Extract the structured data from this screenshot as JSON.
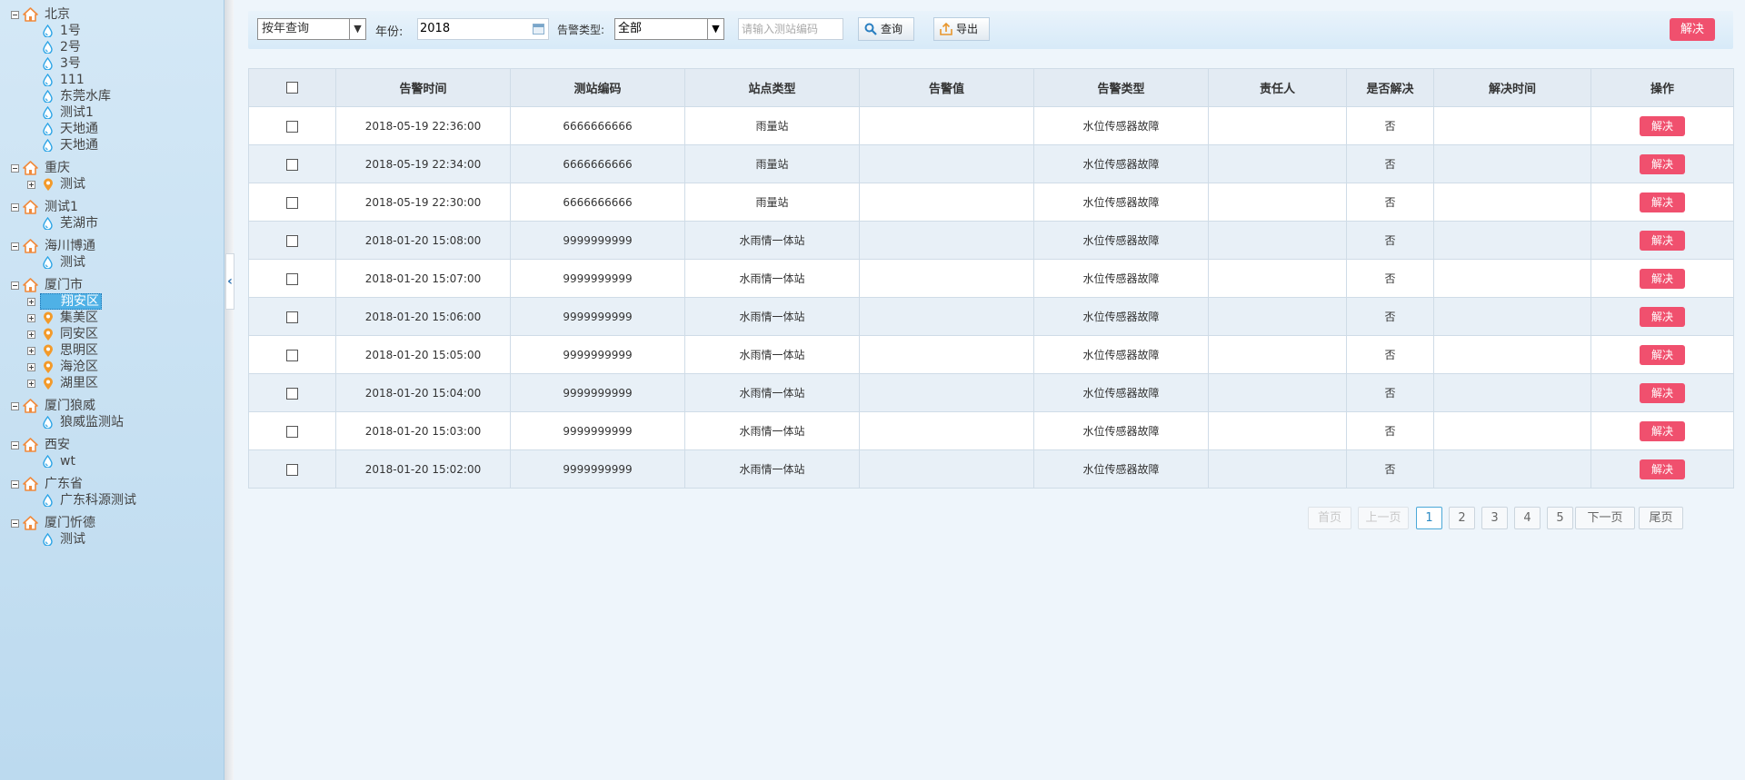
{
  "tree": [
    {
      "label": "北京",
      "children": [
        {
          "label": "1号",
          "icon": "water-drop-icon"
        },
        {
          "label": "2号",
          "icon": "water-drop-icon"
        },
        {
          "label": "3号",
          "icon": "water-drop-icon"
        },
        {
          "label": "111",
          "icon": "water-drop-icon"
        },
        {
          "label": "东莞水库",
          "icon": "water-drop-icon"
        },
        {
          "label": "测试1",
          "icon": "water-drop-icon"
        },
        {
          "label": "天地通",
          "icon": "water-drop-icon"
        },
        {
          "label": "天地通",
          "icon": "water-drop-icon"
        }
      ]
    },
    {
      "label": "重庆",
      "children": [
        {
          "label": "测试",
          "icon": "location-pin-icon",
          "expandable": true
        }
      ]
    },
    {
      "label": "测试1",
      "children": [
        {
          "label": "芜湖市",
          "icon": "water-drop-icon"
        }
      ]
    },
    {
      "label": "海川博通",
      "children": [
        {
          "label": "测试",
          "icon": "water-drop-icon"
        }
      ]
    },
    {
      "label": "厦门市",
      "children": [
        {
          "label": "翔安区",
          "icon": "location-pin-icon",
          "expandable": true,
          "selected": true
        },
        {
          "label": "集美区",
          "icon": "location-pin-icon",
          "expandable": true
        },
        {
          "label": "同安区",
          "icon": "location-pin-icon",
          "expandable": true
        },
        {
          "label": "思明区",
          "icon": "location-pin-icon",
          "expandable": true
        },
        {
          "label": "海沧区",
          "icon": "location-pin-icon",
          "expandable": true
        },
        {
          "label": "湖里区",
          "icon": "location-pin-icon",
          "expandable": true
        }
      ]
    },
    {
      "label": "厦门狼威",
      "children": [
        {
          "label": "狼威监测站",
          "icon": "water-drop-icon"
        }
      ]
    },
    {
      "label": "西安",
      "children": [
        {
          "label": "wt",
          "icon": "water-drop-icon"
        }
      ]
    },
    {
      "label": "广东省",
      "children": [
        {
          "label": "广东科源测试",
          "icon": "water-drop-icon"
        }
      ]
    },
    {
      "label": "厦门忻德",
      "children": [
        {
          "label": "测试",
          "icon": "water-drop-icon"
        }
      ]
    }
  ],
  "toolbar": {
    "query_mode": "按年查询",
    "year_label": "年份:",
    "year_value": "2018",
    "alarm_type_label": "告警类型:",
    "alarm_type_value": "全部",
    "station_placeholder": "请输入测站编码",
    "query_button": "查询",
    "export_button": "导出",
    "solve_button": "解决"
  },
  "table": {
    "headers": [
      "告警时间",
      "测站编码",
      "站点类型",
      "告警值",
      "告警类型",
      "责任人",
      "是否解决",
      "解决时间",
      "操作"
    ],
    "action_label": "解决",
    "rows": [
      {
        "time": "2018-05-19 22:36:00",
        "code": "6666666666",
        "station_type": "雨量站",
        "value": "",
        "alarm_type": "水位传感器故障",
        "owner": "",
        "solved": "否",
        "solve_time": ""
      },
      {
        "time": "2018-05-19 22:34:00",
        "code": "6666666666",
        "station_type": "雨量站",
        "value": "",
        "alarm_type": "水位传感器故障",
        "owner": "",
        "solved": "否",
        "solve_time": ""
      },
      {
        "time": "2018-05-19 22:30:00",
        "code": "6666666666",
        "station_type": "雨量站",
        "value": "",
        "alarm_type": "水位传感器故障",
        "owner": "",
        "solved": "否",
        "solve_time": ""
      },
      {
        "time": "2018-01-20 15:08:00",
        "code": "9999999999",
        "station_type": "水雨情一体站",
        "value": "",
        "alarm_type": "水位传感器故障",
        "owner": "",
        "solved": "否",
        "solve_time": ""
      },
      {
        "time": "2018-01-20 15:07:00",
        "code": "9999999999",
        "station_type": "水雨情一体站",
        "value": "",
        "alarm_type": "水位传感器故障",
        "owner": "",
        "solved": "否",
        "solve_time": ""
      },
      {
        "time": "2018-01-20 15:06:00",
        "code": "9999999999",
        "station_type": "水雨情一体站",
        "value": "",
        "alarm_type": "水位传感器故障",
        "owner": "",
        "solved": "否",
        "solve_time": ""
      },
      {
        "time": "2018-01-20 15:05:00",
        "code": "9999999999",
        "station_type": "水雨情一体站",
        "value": "",
        "alarm_type": "水位传感器故障",
        "owner": "",
        "solved": "否",
        "solve_time": ""
      },
      {
        "time": "2018-01-20 15:04:00",
        "code": "9999999999",
        "station_type": "水雨情一体站",
        "value": "",
        "alarm_type": "水位传感器故障",
        "owner": "",
        "solved": "否",
        "solve_time": ""
      },
      {
        "time": "2018-01-20 15:03:00",
        "code": "9999999999",
        "station_type": "水雨情一体站",
        "value": "",
        "alarm_type": "水位传感器故障",
        "owner": "",
        "solved": "否",
        "solve_time": ""
      },
      {
        "time": "2018-01-20 15:02:00",
        "code": "9999999999",
        "station_type": "水雨情一体站",
        "value": "",
        "alarm_type": "水位传感器故障",
        "owner": "",
        "solved": "否",
        "solve_time": ""
      }
    ]
  },
  "pagination": {
    "first": "首页",
    "prev": "上一页",
    "pages": [
      "1",
      "2",
      "3",
      "4",
      "5"
    ],
    "current": "1",
    "next": "下一页",
    "last": "尾页"
  },
  "colors": {
    "accent_red": "#f0506e",
    "selected_node": "#4fb1e6",
    "house_icon": "#f08a3c",
    "drop_icon": "#29a3e6",
    "pin_icon": "#f39a2a"
  }
}
